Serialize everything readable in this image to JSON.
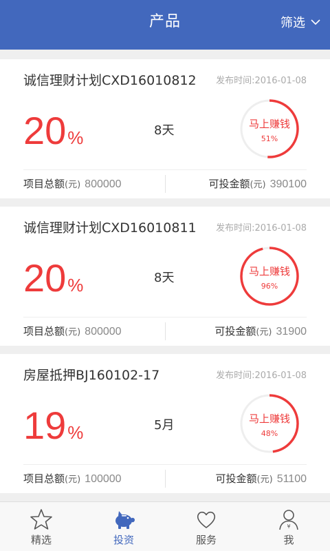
{
  "header": {
    "title": "产品",
    "filter_label": "筛选"
  },
  "products": [
    {
      "name": "诚信理财计划CXD16010812",
      "date_label": "发布时间:2016-01-08",
      "rate": "20",
      "rate_unit": "%",
      "term": "8天",
      "cta": "马上赚钱",
      "progress_label": "51%",
      "progress": 0.51,
      "total_label": "项目总额",
      "total_unit": "(元)",
      "total_value": "800000",
      "available_label": "可投金额",
      "available_unit": "(元)",
      "available_value": "390100"
    },
    {
      "name": "诚信理财计划CXD16010811",
      "date_label": "发布时间:2016-01-08",
      "rate": "20",
      "rate_unit": "%",
      "term": "8天",
      "cta": "马上赚钱",
      "progress_label": "96%",
      "progress": 0.96,
      "total_label": "项目总额",
      "total_unit": "(元)",
      "total_value": "800000",
      "available_label": "可投金额",
      "available_unit": "(元)",
      "available_value": "31900"
    },
    {
      "name": "房屋抵押BJ160102-17",
      "date_label": "发布时间:2016-01-08",
      "rate": "19",
      "rate_unit": "%",
      "term": "5月",
      "cta": "马上赚钱",
      "progress_label": "48%",
      "progress": 0.48,
      "total_label": "项目总额",
      "total_unit": "(元)",
      "total_value": "100000",
      "available_label": "可投金额",
      "available_unit": "(元)",
      "available_value": "51100"
    }
  ],
  "tabs": [
    {
      "label": "精选",
      "icon": "star-icon",
      "active": false
    },
    {
      "label": "投资",
      "icon": "piggy-bank-icon",
      "active": true
    },
    {
      "label": "服务",
      "icon": "heart-icon",
      "active": false
    },
    {
      "label": "我",
      "icon": "user-icon",
      "active": false
    }
  ],
  "colors": {
    "primary": "#4268bd",
    "accent": "#ee3b3b",
    "ring_track": "#eeeeee"
  }
}
